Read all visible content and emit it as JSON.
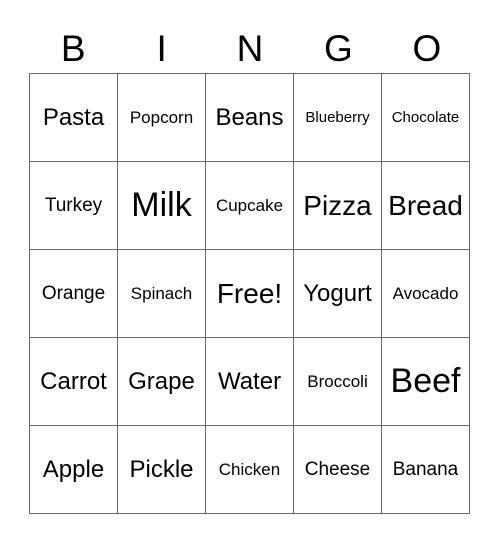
{
  "header": [
    "B",
    "I",
    "N",
    "G",
    "O"
  ],
  "cells": [
    [
      "Pasta",
      "Popcorn",
      "Beans",
      "Blueberry",
      "Chocolate"
    ],
    [
      "Turkey",
      "Milk",
      "Cupcake",
      "Pizza",
      "Bread"
    ],
    [
      "Orange",
      "Spinach",
      "Free!",
      "Yogurt",
      "Avocado"
    ],
    [
      "Carrot",
      "Grape",
      "Water",
      "Broccoli",
      "Beef"
    ],
    [
      "Apple",
      "Pickle",
      "Chicken",
      "Cheese",
      "Banana"
    ]
  ]
}
